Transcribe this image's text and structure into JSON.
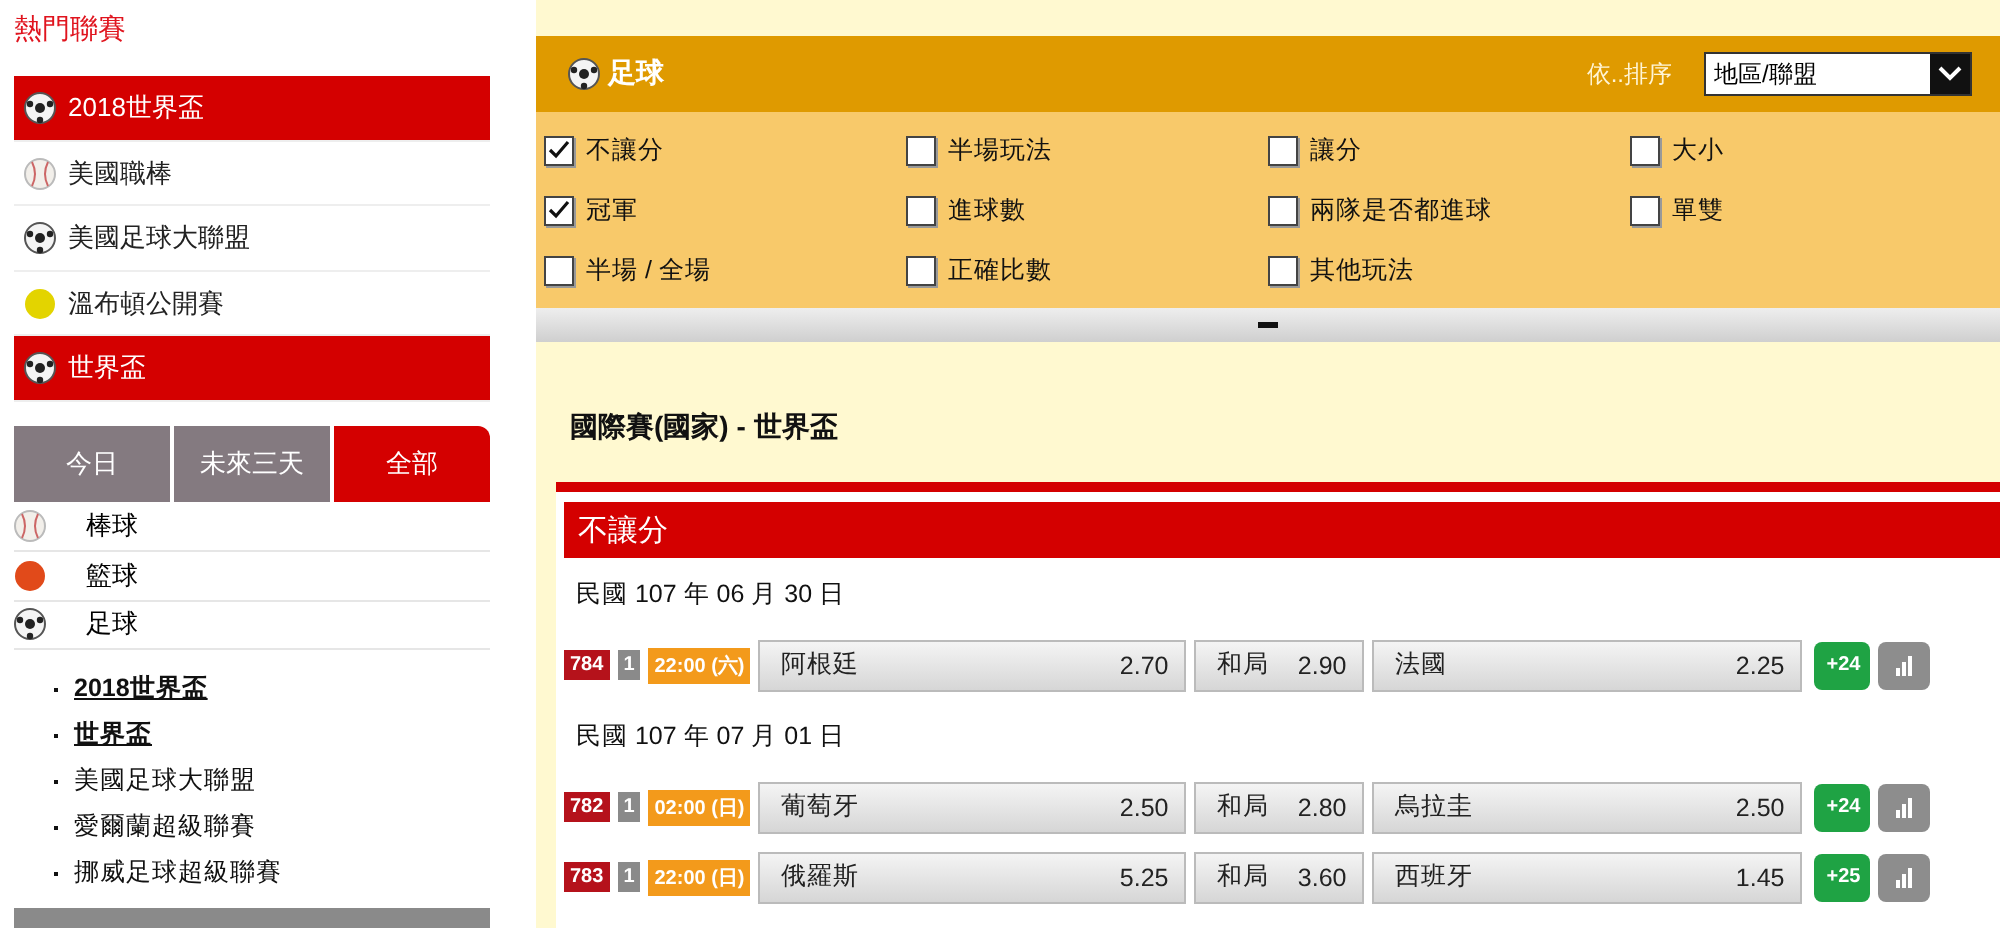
{
  "sidebar": {
    "title": "熱門聯賽",
    "leagues": [
      {
        "label": "2018世界盃",
        "kind": "soccer",
        "selected": true
      },
      {
        "label": "美國職棒",
        "kind": "baseball",
        "selected": false
      },
      {
        "label": "美國足球大聯盟",
        "kind": "soccer",
        "selected": false
      },
      {
        "label": "溫布頓公開賽",
        "kind": "tennis",
        "selected": false
      },
      {
        "label": "世界盃",
        "kind": "soccer",
        "selected": true
      }
    ],
    "tabs": [
      {
        "label": "今日",
        "selected": false
      },
      {
        "label": "未來三天",
        "selected": false
      },
      {
        "label": "全部",
        "selected": true
      }
    ],
    "sports": [
      {
        "label": "棒球",
        "kind": "baseball"
      },
      {
        "label": "籃球",
        "kind": "basketball"
      },
      {
        "label": "足球",
        "kind": "soccer"
      }
    ],
    "sub_leagues": [
      {
        "label": "2018世界盃",
        "selected": true
      },
      {
        "label": "世界盃",
        "selected": true
      },
      {
        "label": "美國足球大聯盟",
        "selected": false
      },
      {
        "label": "愛爾蘭超級聯賽",
        "selected": false
      },
      {
        "label": "挪威足球超級聯賽",
        "selected": false
      }
    ]
  },
  "panel": {
    "title": "足球",
    "sort_label": "依..排序",
    "sort_value": "地區/聯盟",
    "markets": [
      {
        "label": "不讓分",
        "checked": true
      },
      {
        "label": "半場玩法",
        "checked": false
      },
      {
        "label": "讓分",
        "checked": false
      },
      {
        "label": "大小",
        "checked": false
      },
      {
        "label": "冠軍",
        "checked": true
      },
      {
        "label": "進球數",
        "checked": false
      },
      {
        "label": "兩隊是否都進球",
        "checked": false
      },
      {
        "label": "單雙",
        "checked": false
      },
      {
        "label": "半場 / 全場",
        "checked": false
      },
      {
        "label": "正確比數",
        "checked": false
      },
      {
        "label": "其他玩法",
        "checked": false
      }
    ]
  },
  "section": {
    "title": "國際賽(國家) - 世界盃",
    "market": "不讓分",
    "days": [
      {
        "date": "民國 107 年 06 月 30 日",
        "matches": [
          {
            "code": "784",
            "period": "1",
            "time": "22:00 (六)",
            "home": "阿根廷",
            "home_odds": "2.70",
            "draw": "和局",
            "draw_odds": "2.90",
            "away": "法國",
            "away_odds": "2.25",
            "more": "+24"
          }
        ]
      },
      {
        "date": "民國 107 年 07 月 01 日",
        "matches": [
          {
            "code": "782",
            "period": "1",
            "time": "02:00 (日)",
            "home": "葡萄牙",
            "home_odds": "2.50",
            "draw": "和局",
            "draw_odds": "2.80",
            "away": "烏拉圭",
            "away_odds": "2.50",
            "more": "+24"
          },
          {
            "code": "783",
            "period": "1",
            "time": "22:00 (日)",
            "home": "俄羅斯",
            "home_odds": "5.25",
            "draw": "和局",
            "draw_odds": "3.60",
            "away": "西班牙",
            "away_odds": "1.45",
            "more": "+25"
          }
        ]
      }
    ]
  }
}
